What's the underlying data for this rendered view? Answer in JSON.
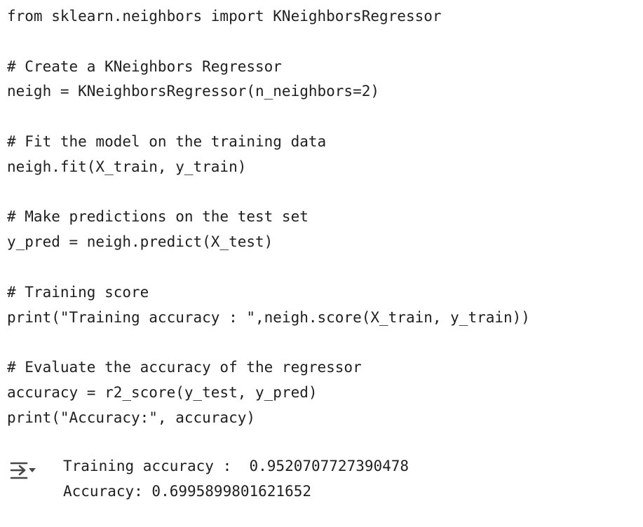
{
  "code_cell": {
    "lines": [
      "from sklearn.neighbors import KNeighborsRegressor",
      "",
      "# Create a KNeighbors Regressor",
      "neigh = KNeighborsRegressor(n_neighbors=2)",
      "",
      "# Fit the model on the training data",
      "neigh.fit(X_train, y_train)",
      "",
      "# Make predictions on the test set",
      "y_pred = neigh.predict(X_test)",
      "",
      "# Training score",
      "print(\"Training accuracy : \",neigh.score(X_train, y_train))",
      "",
      "# Evaluate the accuracy of the regressor",
      "accuracy = r2_score(y_test, y_pred)",
      "print(\"Accuracy:\", accuracy)"
    ]
  },
  "output": {
    "toggle_icon": "output-collapse-icon",
    "lines": [
      "Training accuracy :  0.9520707727390478",
      "Accuracy: 0.6995899801621652"
    ]
  },
  "colors": {
    "text": "#1f1f1f",
    "icon": "#444746",
    "background": "#ffffff"
  }
}
